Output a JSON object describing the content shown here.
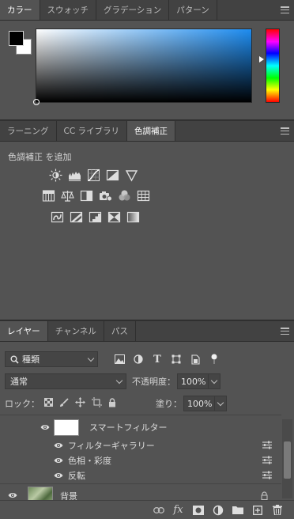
{
  "color_panel": {
    "tabs": [
      "カラー",
      "スウォッチ",
      "グラデーション",
      "パターン"
    ],
    "active_tab": "カラー",
    "foreground_color": "#000000",
    "background_color": "#ffffff",
    "field_hue": "#1d8cf0"
  },
  "adjust_panel": {
    "tabs": [
      "ラーニング",
      "CC ライブラリ",
      "色調補正"
    ],
    "active_tab": "色調補正",
    "title": "色調補正 を追加",
    "icons_row1": [
      "brightness-contrast-icon",
      "levels-icon",
      "curves-icon",
      "exposure-icon",
      "vibrance-icon"
    ],
    "icons_row2": [
      "hue-saturation-icon",
      "color-balance-icon",
      "black-white-icon",
      "photo-filter-icon",
      "channel-mixer-icon",
      "color-lookup-icon"
    ],
    "icons_row3": [
      "invert-icon",
      "posterize-icon",
      "threshold-icon",
      "selective-color-icon",
      "gradient-map-icon"
    ]
  },
  "layers_panel": {
    "tabs": [
      "レイヤー",
      "チャンネル",
      "パス"
    ],
    "active_tab": "レイヤー",
    "filter_kind": "種類",
    "blend_mode": "通常",
    "opacity_label": "不透明度：",
    "opacity_value": "100%",
    "lock_label": "ロック：",
    "fill_label": "塗り：",
    "fill_value": "100%",
    "layers": {
      "smart_filter": "スマートフィルター",
      "filter_gallery": "フィルターギャラリー",
      "hue_saturation": "色相・彩度",
      "invert": "反転",
      "background": "背景"
    },
    "bottom_fx": "fx"
  }
}
